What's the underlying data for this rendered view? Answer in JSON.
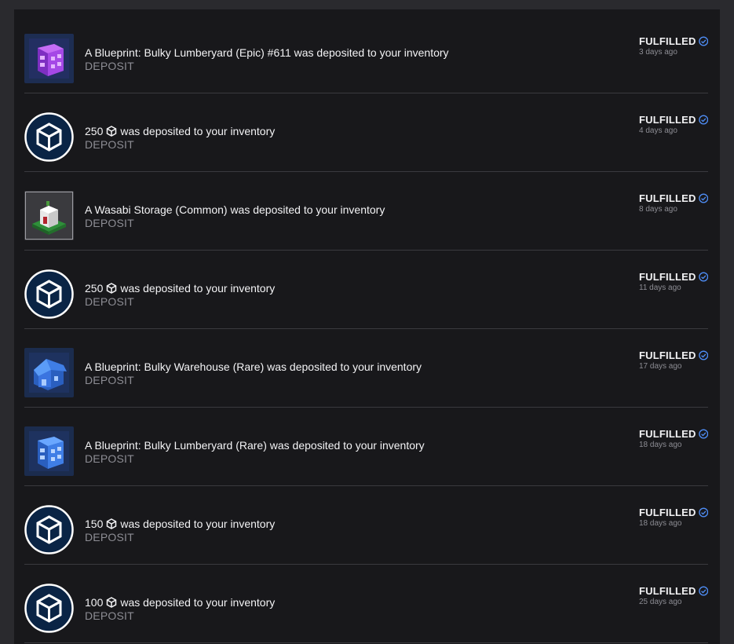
{
  "status_label": "FULFILLED",
  "status_icon": "check-circle-icon",
  "accent_color": "#4f8ef7",
  "deposits": [
    {
      "thumb": "purple-blueprint-building",
      "title_prefix": "A Blueprint: Bulky Lumberyard (Epic) #611 was deposited to your inventory",
      "token_icon": false,
      "title_suffix": "",
      "type": "DEPOSIT",
      "status": "FULFILLED",
      "ago": "3 days ago"
    },
    {
      "thumb": "gala-token-logo",
      "title_prefix": "250",
      "token_icon": true,
      "title_suffix": "was deposited to your inventory",
      "type": "DEPOSIT",
      "status": "FULFILLED",
      "ago": "4 days ago"
    },
    {
      "thumb": "wasabi-storage-building",
      "title_prefix": "A Wasabi Storage (Common) was deposited to your inventory",
      "token_icon": false,
      "title_suffix": "",
      "type": "DEPOSIT",
      "status": "FULFILLED",
      "ago": "8 days ago"
    },
    {
      "thumb": "gala-token-logo",
      "title_prefix": "250",
      "token_icon": true,
      "title_suffix": "was deposited to your inventory",
      "type": "DEPOSIT",
      "status": "FULFILLED",
      "ago": "11 days ago"
    },
    {
      "thumb": "blue-warehouse-blueprint",
      "title_prefix": "A Blueprint: Bulky Warehouse (Rare) was deposited to your inventory",
      "token_icon": false,
      "title_suffix": "",
      "type": "DEPOSIT",
      "status": "FULFILLED",
      "ago": "17 days ago"
    },
    {
      "thumb": "blue-lumberyard-blueprint",
      "title_prefix": "A Blueprint: Bulky Lumberyard (Rare) was deposited to your inventory",
      "token_icon": false,
      "title_suffix": "",
      "type": "DEPOSIT",
      "status": "FULFILLED",
      "ago": "18 days ago"
    },
    {
      "thumb": "gala-token-logo",
      "title_prefix": "150",
      "token_icon": true,
      "title_suffix": "was deposited to your inventory",
      "type": "DEPOSIT",
      "status": "FULFILLED",
      "ago": "18 days ago"
    },
    {
      "thumb": "gala-token-logo",
      "title_prefix": "100",
      "token_icon": true,
      "title_suffix": "was deposited to your inventory",
      "type": "DEPOSIT",
      "status": "FULFILLED",
      "ago": "25 days ago"
    }
  ]
}
